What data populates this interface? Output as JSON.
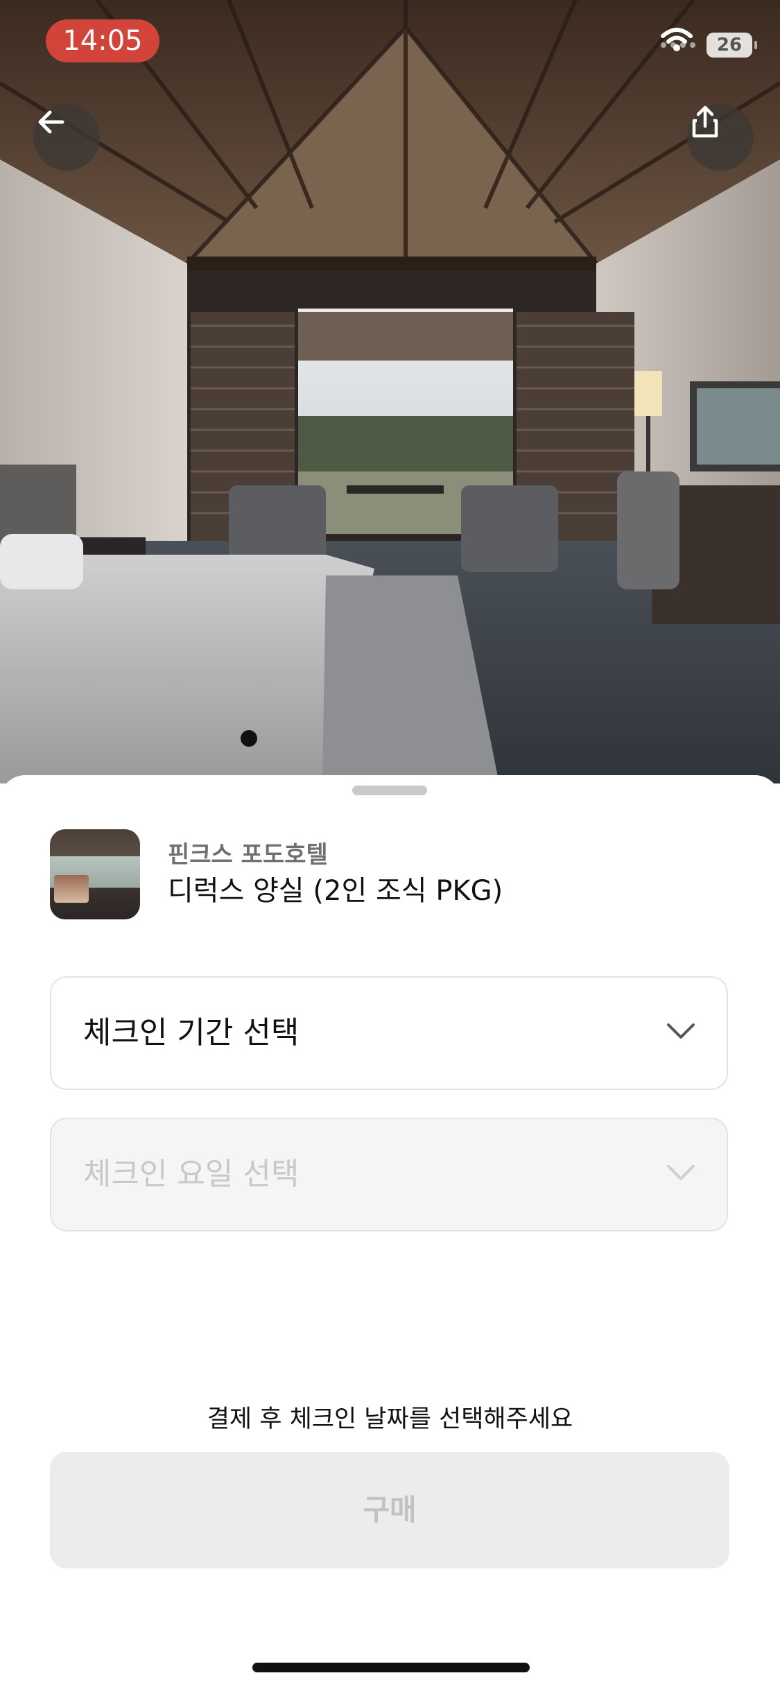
{
  "status_bar": {
    "time": "14:05",
    "battery": "26"
  },
  "hero": {
    "icons": [
      "back-arrow-icon",
      "share-icon"
    ],
    "page_index": 1
  },
  "product": {
    "hotel": "핀크스 포도호텔",
    "room": "디럭스 양실 (2인 조식 PKG)"
  },
  "selects": {
    "period": {
      "label": "체크인 기간 선택",
      "enabled": true
    },
    "day": {
      "label": "체크인 요일 선택",
      "enabled": false
    }
  },
  "footer": {
    "notice": "결제 후 체크인 날짜를 선택해주세요",
    "buy_label": "구매"
  },
  "colors": {
    "time_pill": "#d2433a",
    "disabled_button": "#ececec"
  }
}
